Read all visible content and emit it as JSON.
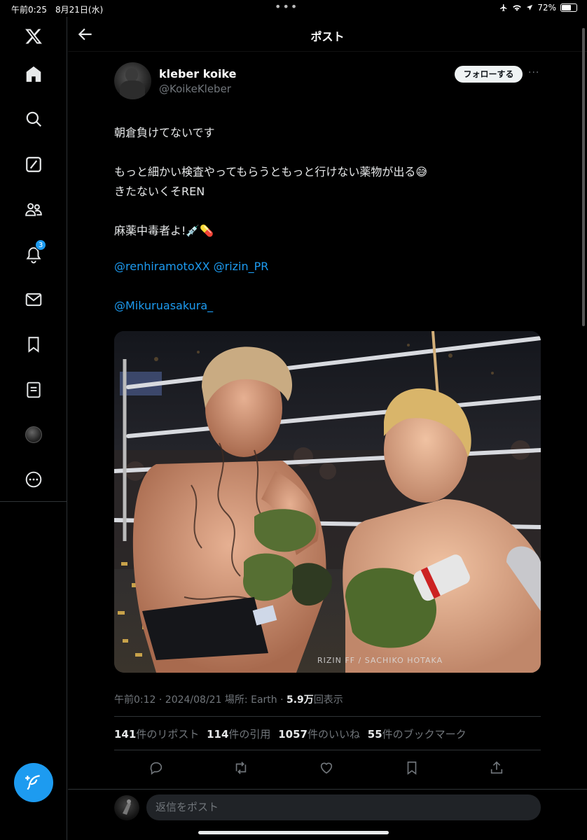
{
  "status_bar": {
    "time": "午前0:25　8月21日(水)",
    "battery": "72%",
    "battery_level": 0.72
  },
  "sidebar": {
    "items": [
      {
        "name": "x-logo-icon"
      },
      {
        "name": "home-icon"
      },
      {
        "name": "search-icon"
      },
      {
        "name": "grok-icon"
      },
      {
        "name": "communities-icon"
      },
      {
        "name": "notifications-icon",
        "badge": "3"
      },
      {
        "name": "messages-icon"
      },
      {
        "name": "bookmarks-icon"
      },
      {
        "name": "lists-icon"
      },
      {
        "name": "profile-avatar"
      },
      {
        "name": "more-icon"
      }
    ],
    "compose_icon": "feather-plus-icon"
  },
  "header": {
    "title": "ポスト",
    "back_icon": "arrow-left-icon"
  },
  "tweet": {
    "display_name": "kleber koike",
    "handle": "@KoikeKleber",
    "follow_label": "フォローする",
    "more_label": "···",
    "lines": [
      "朝倉負けてないです",
      "もっと細かい検査やってもらうともっと行けない薬物が出る😅",
      "きたないくそREN",
      "麻薬中毒者よ!💉💊"
    ],
    "mentions_line1": "@renhiramotoXX @rizin_PR",
    "mentions_line2": "@Mikuruasakura_",
    "photo_watermark": "RIZIN FF / SACHIKO HOTAKA",
    "meta": {
      "time": "午前0:12 · 2024/08/21 場所: Earth · ",
      "views_count": "5.9万",
      "views_label": "回表示"
    },
    "stats": {
      "reposts_count": "141",
      "reposts_label": "件のリポスト",
      "quotes_count": "114",
      "quotes_label": "件の引用",
      "likes_count": "1057",
      "likes_label": "件のいいね",
      "bookmarks_count": "55",
      "bookmarks_label": "件のブックマーク"
    },
    "actions": [
      "reply-icon",
      "repost-icon",
      "like-icon",
      "bookmark-icon",
      "share-icon"
    ]
  },
  "reply": {
    "placeholder": "返信をポスト"
  },
  "colors": {
    "background": "#000000",
    "accent": "#1d9bf0",
    "text": "#e7e9ea",
    "muted": "#71767b",
    "divider": "#2f3336"
  }
}
